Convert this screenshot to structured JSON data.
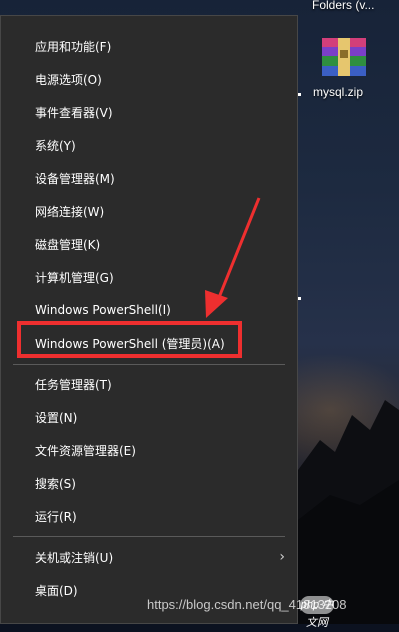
{
  "desktop": {
    "top_label": "Folders (v...",
    "file_icon": "winrar-archive-icon",
    "file_label": "mysql.zip"
  },
  "menu": {
    "items": [
      {
        "label": "应用和功能(F)"
      },
      {
        "label": "电源选项(O)"
      },
      {
        "label": "事件查看器(V)"
      },
      {
        "label": "系统(Y)"
      },
      {
        "label": "设备管理器(M)"
      },
      {
        "label": "网络连接(W)"
      },
      {
        "label": "磁盘管理(K)"
      },
      {
        "label": "计算机管理(G)"
      },
      {
        "label": "Windows PowerShell(I)"
      },
      {
        "label": "Windows PowerShell (管理员)(A)"
      },
      {
        "label": "任务管理器(T)"
      },
      {
        "label": "设置(N)"
      },
      {
        "label": "文件资源管理器(E)"
      },
      {
        "label": "搜索(S)"
      },
      {
        "label": "运行(R)"
      },
      {
        "label": "关机或注销(U)",
        "submenu_icon": "chevron-right-icon"
      },
      {
        "label": "桌面(D)"
      }
    ]
  },
  "annotation": {
    "highlighted_item": "Windows PowerShell (管理员)(A)",
    "color": "#ee2f2f"
  },
  "watermark": {
    "text": "https://blog.csdn.net/qq_41813208",
    "logo": "php 中文网"
  },
  "colors": {
    "menu_bg": "#2b2b2b",
    "menu_text": "#ffffff",
    "separator": "#5a5a5a"
  }
}
